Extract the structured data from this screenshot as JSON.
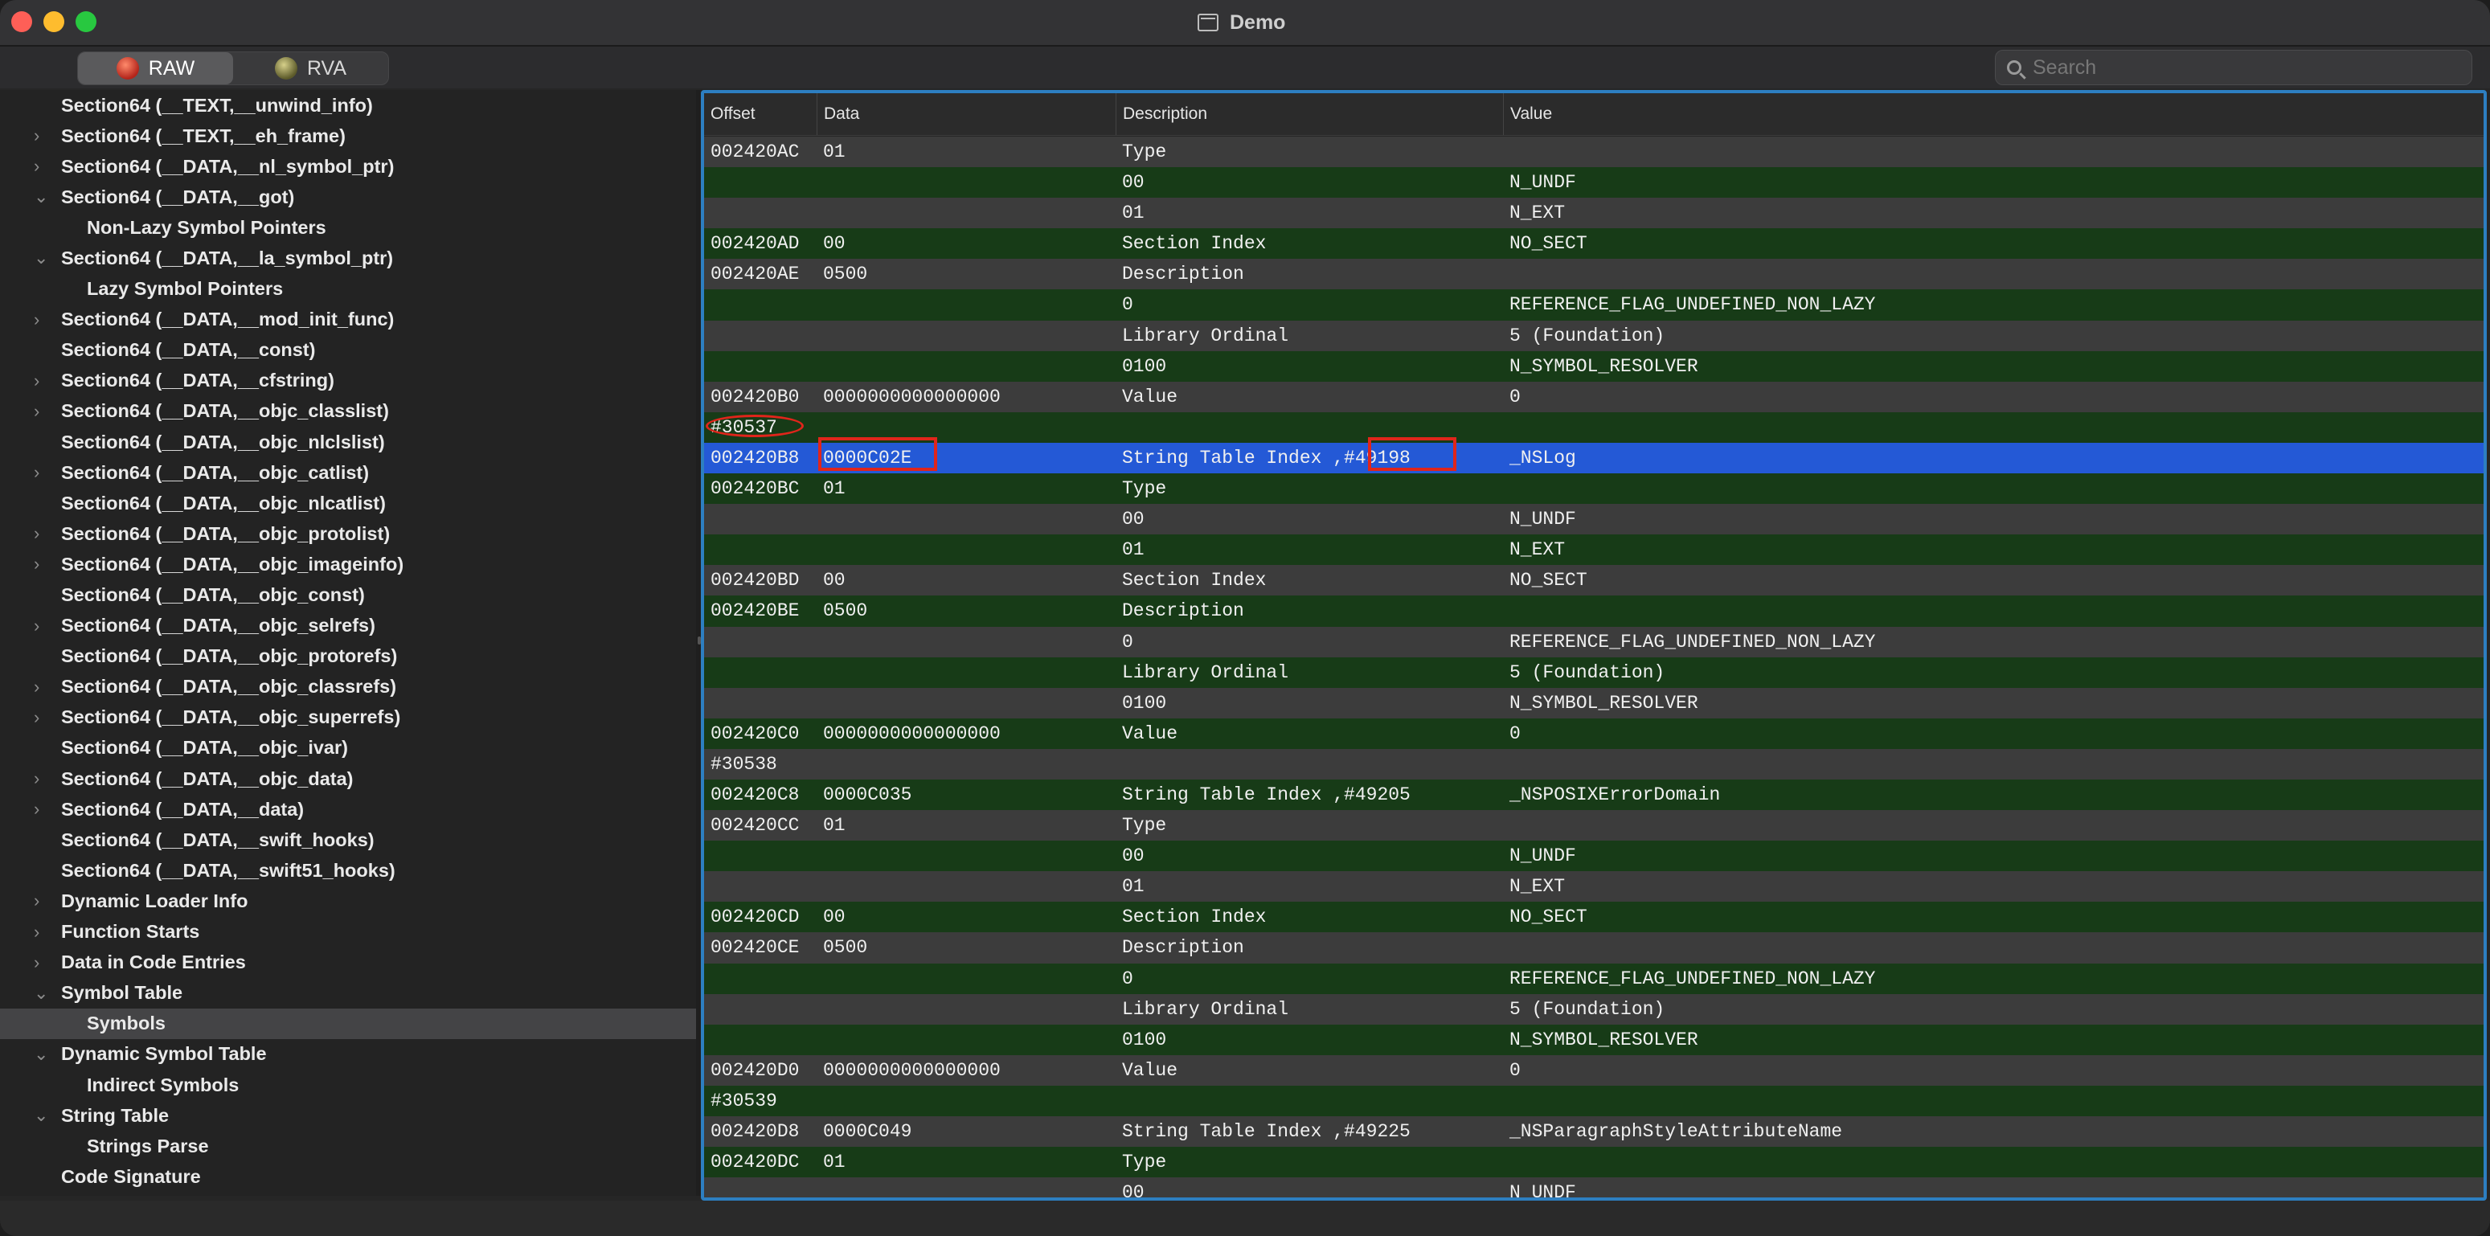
{
  "window": {
    "title": "Demo"
  },
  "toolbar": {
    "modes": [
      {
        "label": "RAW",
        "active": true
      },
      {
        "label": "RVA",
        "active": false
      }
    ],
    "search_placeholder": "Search"
  },
  "sidebar": {
    "items": [
      {
        "label": "Section64 (__TEXT,__unwind_info)",
        "level": 0,
        "chevron": ""
      },
      {
        "label": "Section64 (__TEXT,__eh_frame)",
        "level": 0,
        "chevron": "›"
      },
      {
        "label": "Section64 (__DATA,__nl_symbol_ptr)",
        "level": 0,
        "chevron": "›"
      },
      {
        "label": "Section64 (__DATA,__got)",
        "level": 0,
        "chevron": "⌄"
      },
      {
        "label": "Non-Lazy Symbol Pointers",
        "level": 1,
        "chevron": ""
      },
      {
        "label": "Section64 (__DATA,__la_symbol_ptr)",
        "level": 0,
        "chevron": "⌄"
      },
      {
        "label": "Lazy Symbol Pointers",
        "level": 1,
        "chevron": ""
      },
      {
        "label": "Section64 (__DATA,__mod_init_func)",
        "level": 0,
        "chevron": "›"
      },
      {
        "label": "Section64 (__DATA,__const)",
        "level": 0,
        "chevron": ""
      },
      {
        "label": "Section64 (__DATA,__cfstring)",
        "level": 0,
        "chevron": "›"
      },
      {
        "label": "Section64 (__DATA,__objc_classlist)",
        "level": 0,
        "chevron": "›"
      },
      {
        "label": "Section64 (__DATA,__objc_nlclslist)",
        "level": 0,
        "chevron": ""
      },
      {
        "label": "Section64 (__DATA,__objc_catlist)",
        "level": 0,
        "chevron": "›"
      },
      {
        "label": "Section64 (__DATA,__objc_nlcatlist)",
        "level": 0,
        "chevron": ""
      },
      {
        "label": "Section64 (__DATA,__objc_protolist)",
        "level": 0,
        "chevron": "›"
      },
      {
        "label": "Section64 (__DATA,__objc_imageinfo)",
        "level": 0,
        "chevron": "›"
      },
      {
        "label": "Section64 (__DATA,__objc_const)",
        "level": 0,
        "chevron": ""
      },
      {
        "label": "Section64 (__DATA,__objc_selrefs)",
        "level": 0,
        "chevron": "›"
      },
      {
        "label": "Section64 (__DATA,__objc_protorefs)",
        "level": 0,
        "chevron": ""
      },
      {
        "label": "Section64 (__DATA,__objc_classrefs)",
        "level": 0,
        "chevron": "›"
      },
      {
        "label": "Section64 (__DATA,__objc_superrefs)",
        "level": 0,
        "chevron": "›"
      },
      {
        "label": "Section64 (__DATA,__objc_ivar)",
        "level": 0,
        "chevron": ""
      },
      {
        "label": "Section64 (__DATA,__objc_data)",
        "level": 0,
        "chevron": "›"
      },
      {
        "label": "Section64 (__DATA,__data)",
        "level": 0,
        "chevron": "›"
      },
      {
        "label": "Section64 (__DATA,__swift_hooks)",
        "level": 0,
        "chevron": ""
      },
      {
        "label": "Section64 (__DATA,__swift51_hooks)",
        "level": 0,
        "chevron": ""
      },
      {
        "label": "Dynamic Loader Info",
        "level": 0,
        "chevron": "›"
      },
      {
        "label": "Function Starts",
        "level": 0,
        "chevron": "›"
      },
      {
        "label": "Data in Code Entries",
        "level": 0,
        "chevron": "›"
      },
      {
        "label": "Symbol Table",
        "level": 0,
        "chevron": "⌄"
      },
      {
        "label": "Symbols",
        "level": 1,
        "chevron": "",
        "selected": true
      },
      {
        "label": "Dynamic Symbol Table",
        "level": 0,
        "chevron": "⌄"
      },
      {
        "label": "Indirect Symbols",
        "level": 1,
        "chevron": ""
      },
      {
        "label": "String Table",
        "level": 0,
        "chevron": "⌄"
      },
      {
        "label": "Strings Parse",
        "level": 1,
        "chevron": ""
      },
      {
        "label": "Code Signature",
        "level": 0,
        "chevron": ""
      }
    ]
  },
  "table": {
    "columns": [
      "Offset",
      "Data",
      "Description",
      "Value"
    ],
    "rows": [
      {
        "offset": "002420AC",
        "data": "01",
        "desc": "Type",
        "value": "",
        "style": "grey"
      },
      {
        "offset": "",
        "data": "",
        "desc": "00",
        "value": "N_UNDF",
        "style": "green"
      },
      {
        "offset": "",
        "data": "",
        "desc": "01",
        "value": "N_EXT",
        "style": "grey"
      },
      {
        "offset": "002420AD",
        "data": "00",
        "desc": "Section Index",
        "value": "NO_SECT",
        "style": "green"
      },
      {
        "offset": "002420AE",
        "data": "0500",
        "desc": "Description",
        "value": "",
        "style": "grey"
      },
      {
        "offset": "",
        "data": "",
        "desc": "0",
        "value": "REFERENCE_FLAG_UNDEFINED_NON_LAZY",
        "style": "green"
      },
      {
        "offset": "",
        "data": "",
        "desc": "Library Ordinal",
        "value": "5 (Foundation)",
        "style": "grey"
      },
      {
        "offset": "",
        "data": "",
        "desc": "0100",
        "value": "N_SYMBOL_RESOLVER",
        "style": "green"
      },
      {
        "offset": "002420B0",
        "data": "0000000000000000",
        "desc": "Value",
        "value": "0",
        "style": "grey"
      },
      {
        "offset": "#30537",
        "data": "",
        "desc": "",
        "value": "",
        "style": "green"
      },
      {
        "offset": "002420B8",
        "data": "0000C02E",
        "desc": "String Table Index ,#49198",
        "value": "_NSLog",
        "style": "selected"
      },
      {
        "offset": "002420BC",
        "data": "01",
        "desc": "Type",
        "value": "",
        "style": "green"
      },
      {
        "offset": "",
        "data": "",
        "desc": "00",
        "value": "N_UNDF",
        "style": "grey"
      },
      {
        "offset": "",
        "data": "",
        "desc": "01",
        "value": "N_EXT",
        "style": "green"
      },
      {
        "offset": "002420BD",
        "data": "00",
        "desc": "Section Index",
        "value": "NO_SECT",
        "style": "grey"
      },
      {
        "offset": "002420BE",
        "data": "0500",
        "desc": "Description",
        "value": "",
        "style": "green"
      },
      {
        "offset": "",
        "data": "",
        "desc": "0",
        "value": "REFERENCE_FLAG_UNDEFINED_NON_LAZY",
        "style": "grey"
      },
      {
        "offset": "",
        "data": "",
        "desc": "Library Ordinal",
        "value": "5 (Foundation)",
        "style": "green"
      },
      {
        "offset": "",
        "data": "",
        "desc": "0100",
        "value": "N_SYMBOL_RESOLVER",
        "style": "grey"
      },
      {
        "offset": "002420C0",
        "data": "0000000000000000",
        "desc": "Value",
        "value": "0",
        "style": "green"
      },
      {
        "offset": "#30538",
        "data": "",
        "desc": "",
        "value": "",
        "style": "grey"
      },
      {
        "offset": "002420C8",
        "data": "0000C035",
        "desc": "String Table Index ,#49205",
        "value": "_NSPOSIXErrorDomain",
        "style": "green"
      },
      {
        "offset": "002420CC",
        "data": "01",
        "desc": "Type",
        "value": "",
        "style": "grey"
      },
      {
        "offset": "",
        "data": "",
        "desc": "00",
        "value": "N_UNDF",
        "style": "green"
      },
      {
        "offset": "",
        "data": "",
        "desc": "01",
        "value": "N_EXT",
        "style": "grey"
      },
      {
        "offset": "002420CD",
        "data": "00",
        "desc": "Section Index",
        "value": "NO_SECT",
        "style": "green"
      },
      {
        "offset": "002420CE",
        "data": "0500",
        "desc": "Description",
        "value": "",
        "style": "grey"
      },
      {
        "offset": "",
        "data": "",
        "desc": "0",
        "value": "REFERENCE_FLAG_UNDEFINED_NON_LAZY",
        "style": "green"
      },
      {
        "offset": "",
        "data": "",
        "desc": "Library Ordinal",
        "value": "5 (Foundation)",
        "style": "grey"
      },
      {
        "offset": "",
        "data": "",
        "desc": "0100",
        "value": "N_SYMBOL_RESOLVER",
        "style": "green"
      },
      {
        "offset": "002420D0",
        "data": "0000000000000000",
        "desc": "Value",
        "value": "0",
        "style": "grey"
      },
      {
        "offset": "#30539",
        "data": "",
        "desc": "",
        "value": "",
        "style": "green"
      },
      {
        "offset": "002420D8",
        "data": "0000C049",
        "desc": "String Table Index ,#49225",
        "value": "_NSParagraphStyleAttributeName",
        "style": "grey"
      },
      {
        "offset": "002420DC",
        "data": "01",
        "desc": "Type",
        "value": "",
        "style": "green"
      },
      {
        "offset": "",
        "data": "",
        "desc": "00",
        "value": "N_UNDF",
        "style": "grey"
      }
    ]
  },
  "colors": {
    "row_green": "#173b17",
    "row_grey": "#3c3c3c",
    "row_selected": "#2459d6",
    "panel_border": "#2d7fc1",
    "highlight_red": "#e0251b"
  }
}
